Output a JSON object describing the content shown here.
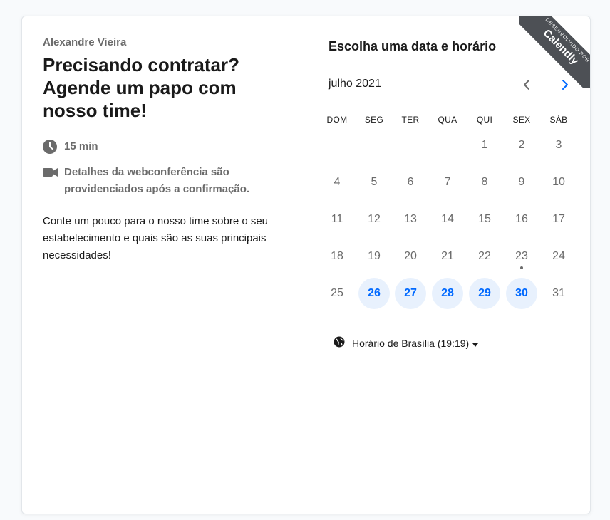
{
  "left": {
    "host": "Alexandre Vieira",
    "title": "Precisando contratar? Agende um papo com nosso time!",
    "duration": "15 min",
    "conference": "Detalhes da webconferência são providenciados após a confirmação.",
    "description": "Conte um pouco para o nosso time sobre o seu estabelecimento e quais são as suas principais necessidades!"
  },
  "right": {
    "heading": "Escolha uma data e horário",
    "month": "julho 2021",
    "weekdays": [
      "DOM",
      "SEG",
      "TER",
      "QUA",
      "QUI",
      "SEX",
      "SÁB"
    ],
    "weeks": [
      [
        "",
        "",
        "",
        "",
        "1",
        "2",
        "3"
      ],
      [
        "4",
        "5",
        "6",
        "7",
        "8",
        "9",
        "10"
      ],
      [
        "11",
        "12",
        "13",
        "14",
        "15",
        "16",
        "17"
      ],
      [
        "18",
        "19",
        "20",
        "21",
        "22",
        "23",
        "24"
      ],
      [
        "25",
        "26",
        "27",
        "28",
        "29",
        "30",
        "31"
      ]
    ],
    "available_days": [
      "26",
      "27",
      "28",
      "29",
      "30"
    ],
    "today": "23",
    "timezone": "Horário de Brasília (19:19)"
  },
  "badge": {
    "line1": "DESENVOLVIDO POR",
    "brand": "Calendly"
  },
  "colors": {
    "accent": "#0069ff",
    "available_bg": "#e8f1fd",
    "ribbon": "#4d5055",
    "muted": "#6b6b6b"
  },
  "icons": {
    "duration": "clock-icon",
    "conference": "video-camera-icon",
    "timezone": "globe-icon",
    "prev": "chevron-left-icon",
    "next": "chevron-right-icon",
    "dropdown": "caret-down-icon"
  }
}
